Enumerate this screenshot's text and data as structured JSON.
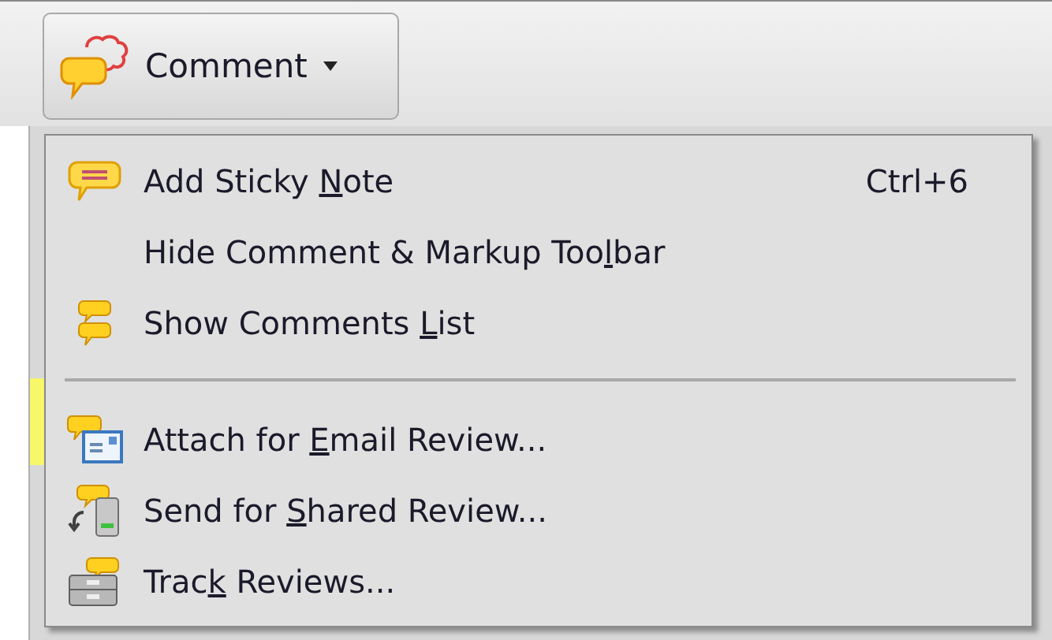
{
  "toolbar": {
    "comment_button": {
      "label": "Comment",
      "expanded": true
    }
  },
  "menu": {
    "items": [
      {
        "kind": "item",
        "label": "Add Sticky Note",
        "shortcut": "Ctrl+6"
      },
      {
        "kind": "item",
        "label": "Hide Comment & Markup Toolbar"
      },
      {
        "kind": "item",
        "label": "Show Comments List"
      },
      {
        "kind": "separator"
      },
      {
        "kind": "item",
        "label": "Attach for Email Review..."
      },
      {
        "kind": "item",
        "label": "Send for Shared Review..."
      },
      {
        "kind": "item",
        "label": "Track Reviews..."
      }
    ]
  }
}
